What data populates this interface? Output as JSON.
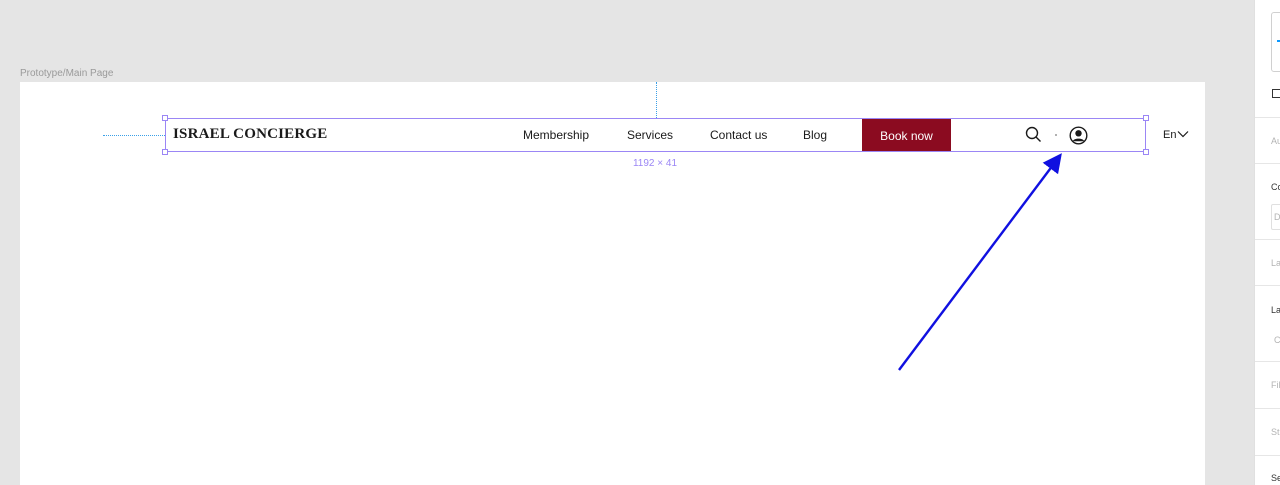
{
  "canvas": {
    "frame_label": "Prototype/Main Page",
    "selection_size": "1192 × 41"
  },
  "nav": {
    "logo": "ISRAEL CONCIERGE",
    "links": [
      "Membership",
      "Services",
      "Contact us",
      "Blog"
    ],
    "cta": "Book now",
    "language": "En",
    "icons": [
      "search-icon",
      "user-icon",
      "chevron-down-icon"
    ]
  },
  "panel": {
    "labels": [
      "Au",
      "Co",
      "D",
      "La",
      "La",
      "C",
      "Fil",
      "St",
      "Se"
    ]
  },
  "colors": {
    "cta_bg": "#8b0b20",
    "selection": "#9b86f5",
    "annotation_arrow": "#1010e0",
    "guide": "#3aa0e8"
  }
}
